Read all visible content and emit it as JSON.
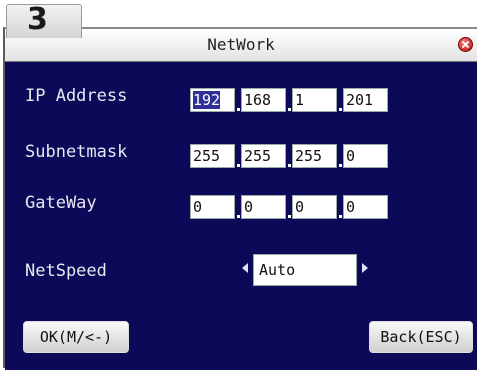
{
  "step": {
    "number": "3"
  },
  "window": {
    "title": "NetWork"
  },
  "rows": {
    "ip": {
      "label": "IP Address",
      "octets": [
        "192",
        "168",
        "1",
        "201"
      ]
    },
    "subnet": {
      "label": "Subnetmask",
      "octets": [
        "255",
        "255",
        "255",
        "0"
      ]
    },
    "gateway": {
      "label": "GateWay",
      "octets": [
        "0",
        "0",
        "0",
        "0"
      ]
    },
    "netspeed": {
      "label": "NetSpeed",
      "value": "Auto"
    }
  },
  "buttons": {
    "ok": "OK(M/<-)",
    "back": "Back(ESC)"
  },
  "colors": {
    "panel_bg": "#0b0958",
    "selection": "#2f2f9a",
    "close": "#c01818"
  },
  "icons": {
    "close": "close-icon",
    "prev": "arrow-left-icon",
    "next": "arrow-right-icon"
  }
}
